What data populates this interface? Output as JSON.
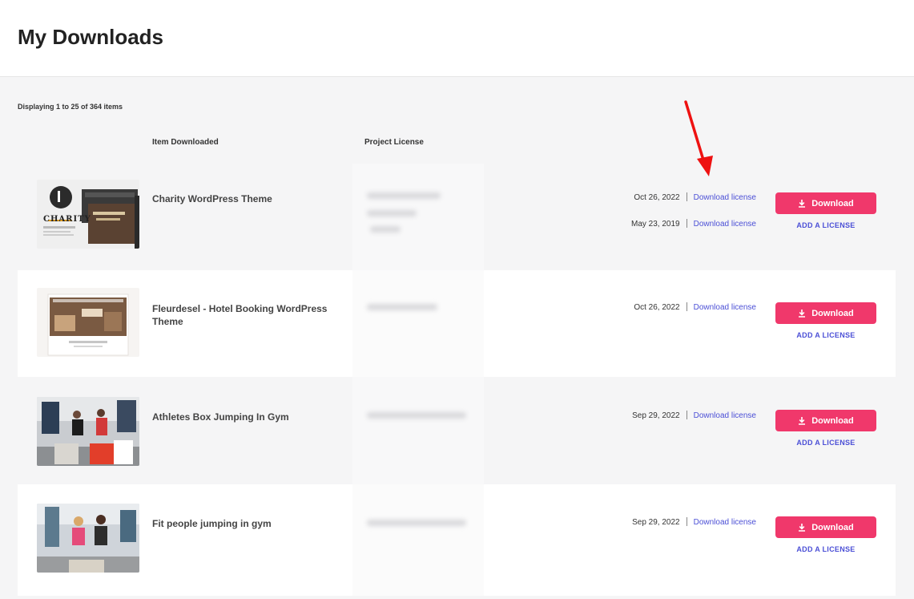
{
  "header": {
    "title": "My Downloads"
  },
  "summary": {
    "text": "Displaying 1 to 25 of 364 items"
  },
  "columns": {
    "item": "Item Downloaded",
    "license": "Project License"
  },
  "colors": {
    "accent": "#f0386b",
    "link": "#4b4fd6",
    "annotation_arrow": "#ee1111"
  },
  "items": [
    {
      "title": "Charity WordPress Theme",
      "licenses": [
        {
          "date": "Oct 26, 2022",
          "link": "Download license"
        },
        {
          "date": "May 23, 2019",
          "link": "Download license"
        }
      ],
      "download_label": "Download",
      "add_license_label": "ADD A LICENSE",
      "thumb_logo": "CHARITY"
    },
    {
      "title": "Fleurdesel - Hotel Booking WordPress Theme",
      "licenses": [
        {
          "date": "Oct 26, 2022",
          "link": "Download license"
        }
      ],
      "download_label": "Download",
      "add_license_label": "ADD A LICENSE"
    },
    {
      "title": "Athletes Box Jumping In Gym",
      "licenses": [
        {
          "date": "Sep 29, 2022",
          "link": "Download license"
        }
      ],
      "download_label": "Download",
      "add_license_label": "ADD A LICENSE"
    },
    {
      "title": "Fit people jumping in gym",
      "licenses": [
        {
          "date": "Sep 29, 2022",
          "link": "Download license"
        }
      ],
      "download_label": "Download",
      "add_license_label": "ADD A LICENSE"
    }
  ]
}
